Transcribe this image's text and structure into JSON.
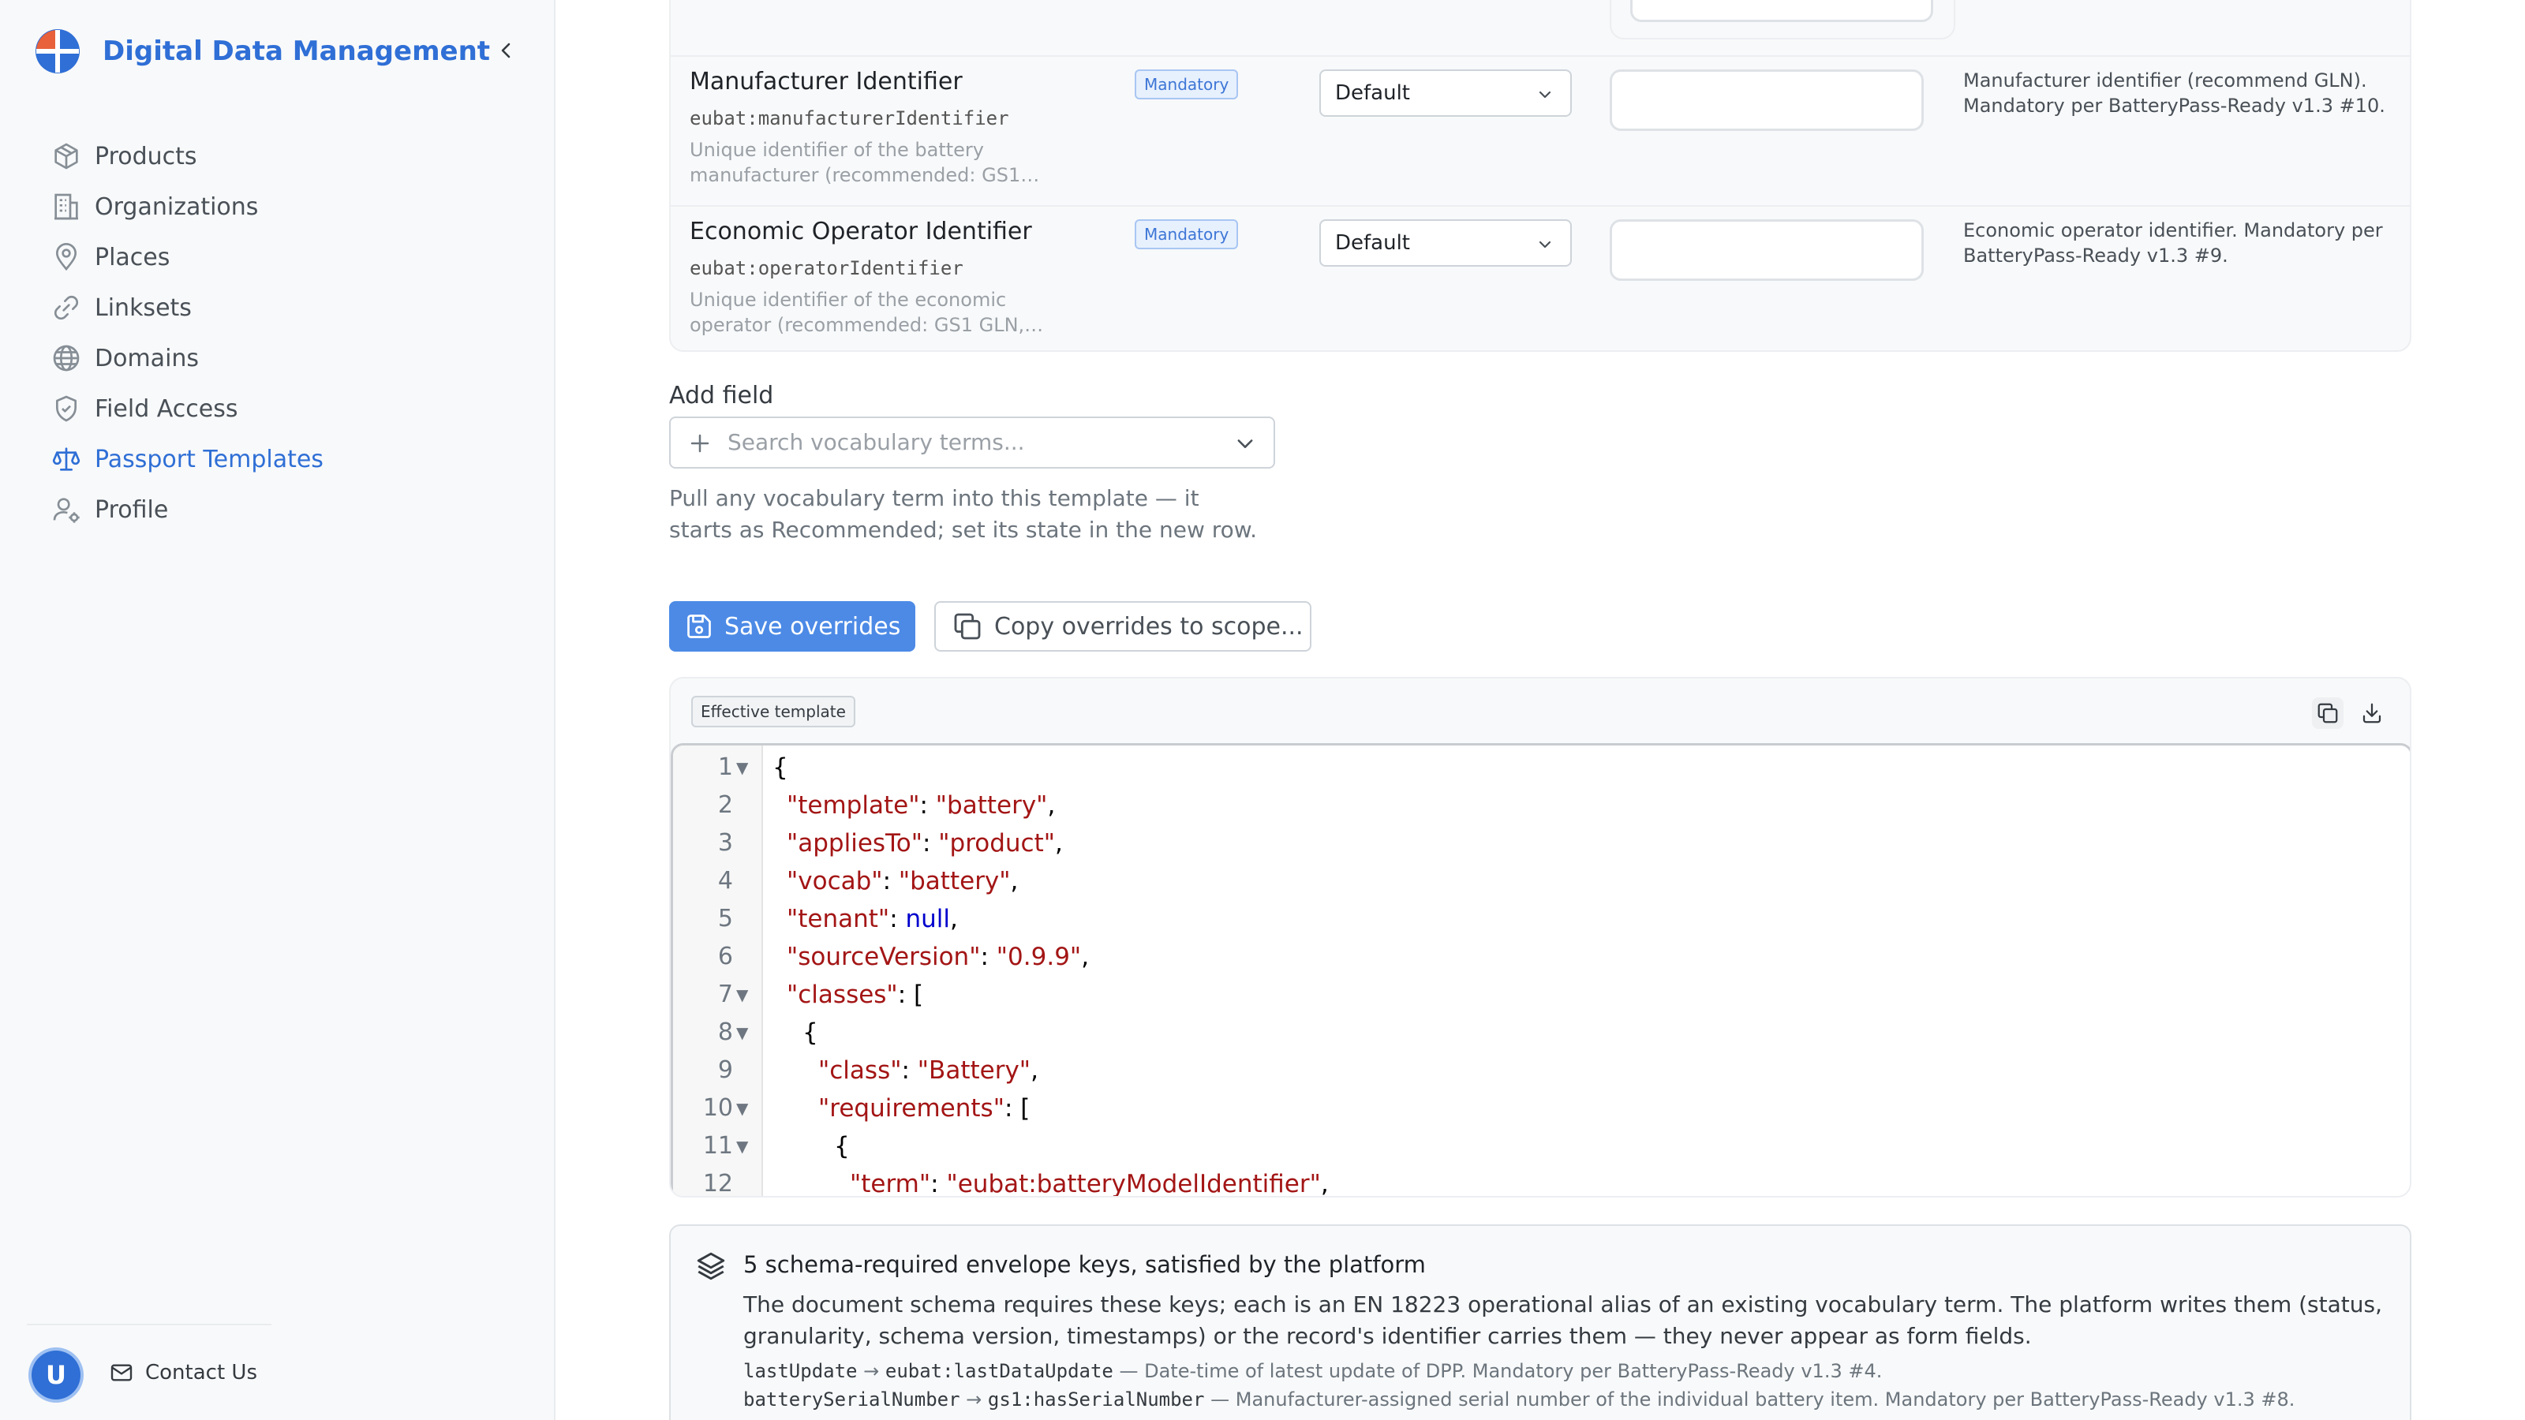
{
  "app": {
    "title": "Digital Data Management",
    "accent": "#2f6fd6"
  },
  "sidebar": {
    "items": [
      {
        "label": "Products",
        "icon": "package-icon"
      },
      {
        "label": "Organizations",
        "icon": "building-icon"
      },
      {
        "label": "Places",
        "icon": "map-pin-icon"
      },
      {
        "label": "Linksets",
        "icon": "link-icon"
      },
      {
        "label": "Domains",
        "icon": "globe-icon"
      },
      {
        "label": "Field Access",
        "icon": "shield-icon"
      },
      {
        "label": "Passport Templates",
        "icon": "scale-icon",
        "active": true
      },
      {
        "label": "Profile",
        "icon": "user-cog-icon"
      }
    ],
    "user_initial": "U",
    "contact_label": "Contact Us"
  },
  "fields": [
    {
      "name": "Manufacturer Identifier",
      "term": "eubat:manufacturerIdentifier",
      "description": "Unique identifier of the battery manufacturer (recommended: GS1…",
      "badge": "Mandatory",
      "select_value": "Default",
      "input_value": "",
      "note": "Manufacturer identifier (recommend GLN). Mandatory per BatteryPass-Ready v1.3 #10."
    },
    {
      "name": "Economic Operator Identifier",
      "term": "eubat:operatorIdentifier",
      "description": "Unique identifier of the economic operator (recommended: GS1 GLN,…",
      "badge": "Mandatory",
      "select_value": "Default",
      "input_value": "",
      "note": "Economic operator identifier. Mandatory per BatteryPass-Ready v1.3 #9."
    }
  ],
  "add_field": {
    "label": "Add field",
    "placeholder": "Search vocabulary terms...",
    "helper": "Pull any vocabulary term into this template — it starts as Recommended; set its state in the new row."
  },
  "buttons": {
    "save": "Save overrides",
    "copy": "Copy overrides to scope..."
  },
  "template": {
    "tag": "Effective template",
    "lines": [
      {
        "n": "1",
        "fold": true
      },
      {
        "n": "2"
      },
      {
        "n": "3"
      },
      {
        "n": "4"
      },
      {
        "n": "5"
      },
      {
        "n": "6"
      },
      {
        "n": "7",
        "fold": true
      },
      {
        "n": "8",
        "fold": true
      },
      {
        "n": "9"
      },
      {
        "n": "10",
        "fold": true
      },
      {
        "n": "11",
        "fold": true
      },
      {
        "n": "12"
      }
    ],
    "code": {
      "template_key": "\"template\"",
      "template_val": "\"battery\"",
      "appliesTo_key": "\"appliesTo\"",
      "appliesTo_val": "\"product\"",
      "vocab_key": "\"vocab\"",
      "vocab_val": "\"battery\"",
      "tenant_key": "\"tenant\"",
      "tenant_val": "null",
      "sourceVersion_key": "\"sourceVersion\"",
      "sourceVersion_val": "\"0.9.9\"",
      "classes_key": "\"classes\"",
      "class_key": "\"class\"",
      "class_val": "\"Battery\"",
      "requirements_key": "\"requirements\"",
      "term_key": "\"term\"",
      "term_val": "\"eubat:batteryModelIdentifier\""
    }
  },
  "envelope": {
    "title": "5 schema-required envelope keys, satisfied by the platform",
    "description": "The document schema requires these keys; each is an EN 18223 operational alias of an existing vocabulary term. The platform writes them (status, granularity, schema version, timestamps) or the record's identifier carries them — they never appear as form fields.",
    "items": [
      {
        "alias": "lastUpdate",
        "term": "eubat:lastDataUpdate",
        "text": "Date-time of latest update of DPP. Mandatory per BatteryPass-Ready v1.3 #4."
      },
      {
        "alias": "batterySerialNumber",
        "term": "gs1:hasSerialNumber",
        "text": "Manufacturer-assigned serial number of the individual battery item. Mandatory per BatteryPass-Ready v1.3 #8."
      }
    ]
  }
}
